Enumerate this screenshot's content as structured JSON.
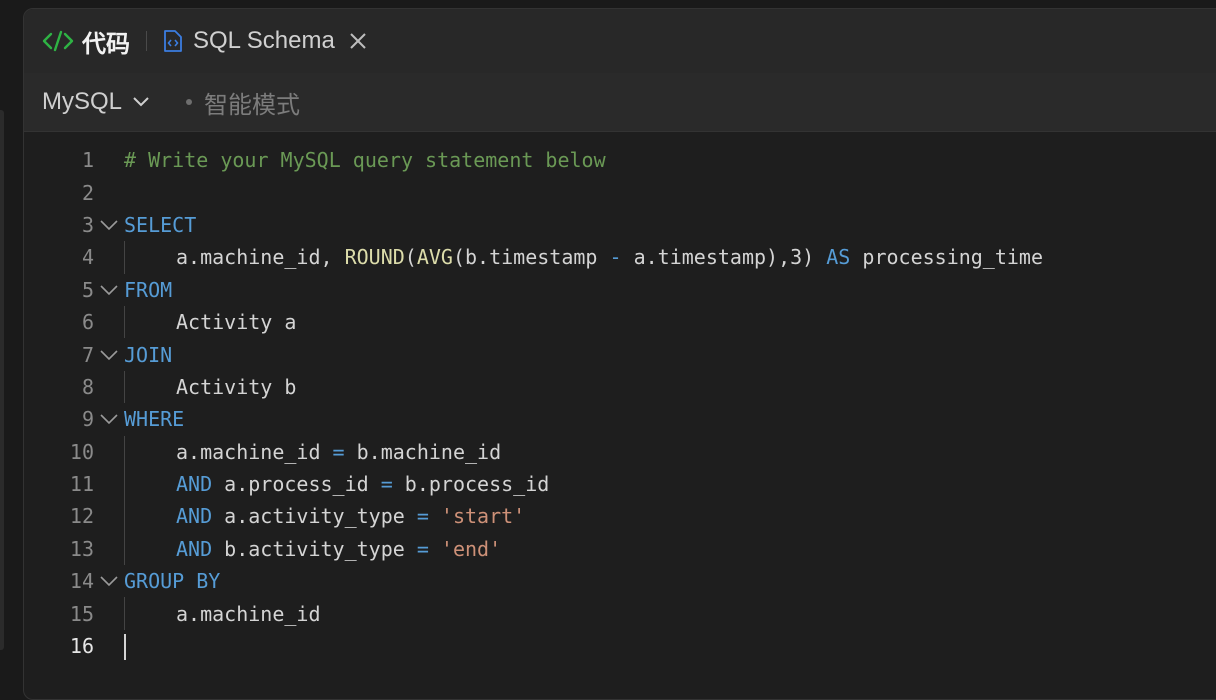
{
  "tabs": {
    "code": {
      "label": "代码",
      "icon": "code-brackets-icon",
      "color": "#2fb344"
    },
    "schema": {
      "label": "SQL Schema",
      "icon": "file-code-icon",
      "color": "#3b7de0"
    }
  },
  "toolbar": {
    "language": "MySQL",
    "mode": "智能模式"
  },
  "editor": {
    "lines": [
      {
        "n": "1",
        "fold": false,
        "indent": false,
        "tokens": [
          {
            "t": "# Write your MySQL query statement below",
            "c": "comment"
          }
        ]
      },
      {
        "n": "2",
        "fold": false,
        "indent": false,
        "tokens": []
      },
      {
        "n": "3",
        "fold": true,
        "indent": false,
        "tokens": [
          {
            "t": "SELECT",
            "c": "kw"
          }
        ]
      },
      {
        "n": "4",
        "fold": false,
        "indent": true,
        "tokens": [
          {
            "t": "a.machine_id, ",
            "c": "id"
          },
          {
            "t": "ROUND",
            "c": "fn"
          },
          {
            "t": "(",
            "c": "id"
          },
          {
            "t": "AVG",
            "c": "fn"
          },
          {
            "t": "(b.timestamp ",
            "c": "id"
          },
          {
            "t": "-",
            "c": "op"
          },
          {
            "t": " a.timestamp),3) ",
            "c": "id"
          },
          {
            "t": "AS",
            "c": "kw"
          },
          {
            "t": " processing_time",
            "c": "id"
          }
        ]
      },
      {
        "n": "5",
        "fold": true,
        "indent": false,
        "tokens": [
          {
            "t": "FROM",
            "c": "kw"
          }
        ]
      },
      {
        "n": "6",
        "fold": false,
        "indent": true,
        "tokens": [
          {
            "t": "Activity a",
            "c": "id"
          }
        ]
      },
      {
        "n": "7",
        "fold": true,
        "indent": false,
        "tokens": [
          {
            "t": "JOIN",
            "c": "kw"
          }
        ]
      },
      {
        "n": "8",
        "fold": false,
        "indent": true,
        "tokens": [
          {
            "t": "Activity b",
            "c": "id"
          }
        ]
      },
      {
        "n": "9",
        "fold": true,
        "indent": false,
        "tokens": [
          {
            "t": "WHERE",
            "c": "kw"
          }
        ]
      },
      {
        "n": "10",
        "fold": false,
        "indent": true,
        "tokens": [
          {
            "t": "a.machine_id ",
            "c": "id"
          },
          {
            "t": "=",
            "c": "op"
          },
          {
            "t": " b.machine_id",
            "c": "id"
          }
        ]
      },
      {
        "n": "11",
        "fold": false,
        "indent": true,
        "tokens": [
          {
            "t": "AND",
            "c": "kw"
          },
          {
            "t": " a.process_id ",
            "c": "id"
          },
          {
            "t": "=",
            "c": "op"
          },
          {
            "t": " b.process_id",
            "c": "id"
          }
        ]
      },
      {
        "n": "12",
        "fold": false,
        "indent": true,
        "tokens": [
          {
            "t": "AND",
            "c": "kw"
          },
          {
            "t": " a.activity_type ",
            "c": "id"
          },
          {
            "t": "=",
            "c": "op"
          },
          {
            "t": " ",
            "c": "id"
          },
          {
            "t": "'start'",
            "c": "str"
          }
        ]
      },
      {
        "n": "13",
        "fold": false,
        "indent": true,
        "tokens": [
          {
            "t": "AND",
            "c": "kw"
          },
          {
            "t": " b.activity_type ",
            "c": "id"
          },
          {
            "t": "=",
            "c": "op"
          },
          {
            "t": " ",
            "c": "id"
          },
          {
            "t": "'end'",
            "c": "str"
          }
        ]
      },
      {
        "n": "14",
        "fold": true,
        "indent": false,
        "tokens": [
          {
            "t": "GROUP BY",
            "c": "kw"
          }
        ]
      },
      {
        "n": "15",
        "fold": false,
        "indent": true,
        "tokens": [
          {
            "t": "a.machine_id",
            "c": "id"
          }
        ]
      },
      {
        "n": "16",
        "fold": false,
        "indent": false,
        "active": true,
        "tokens": []
      }
    ]
  }
}
